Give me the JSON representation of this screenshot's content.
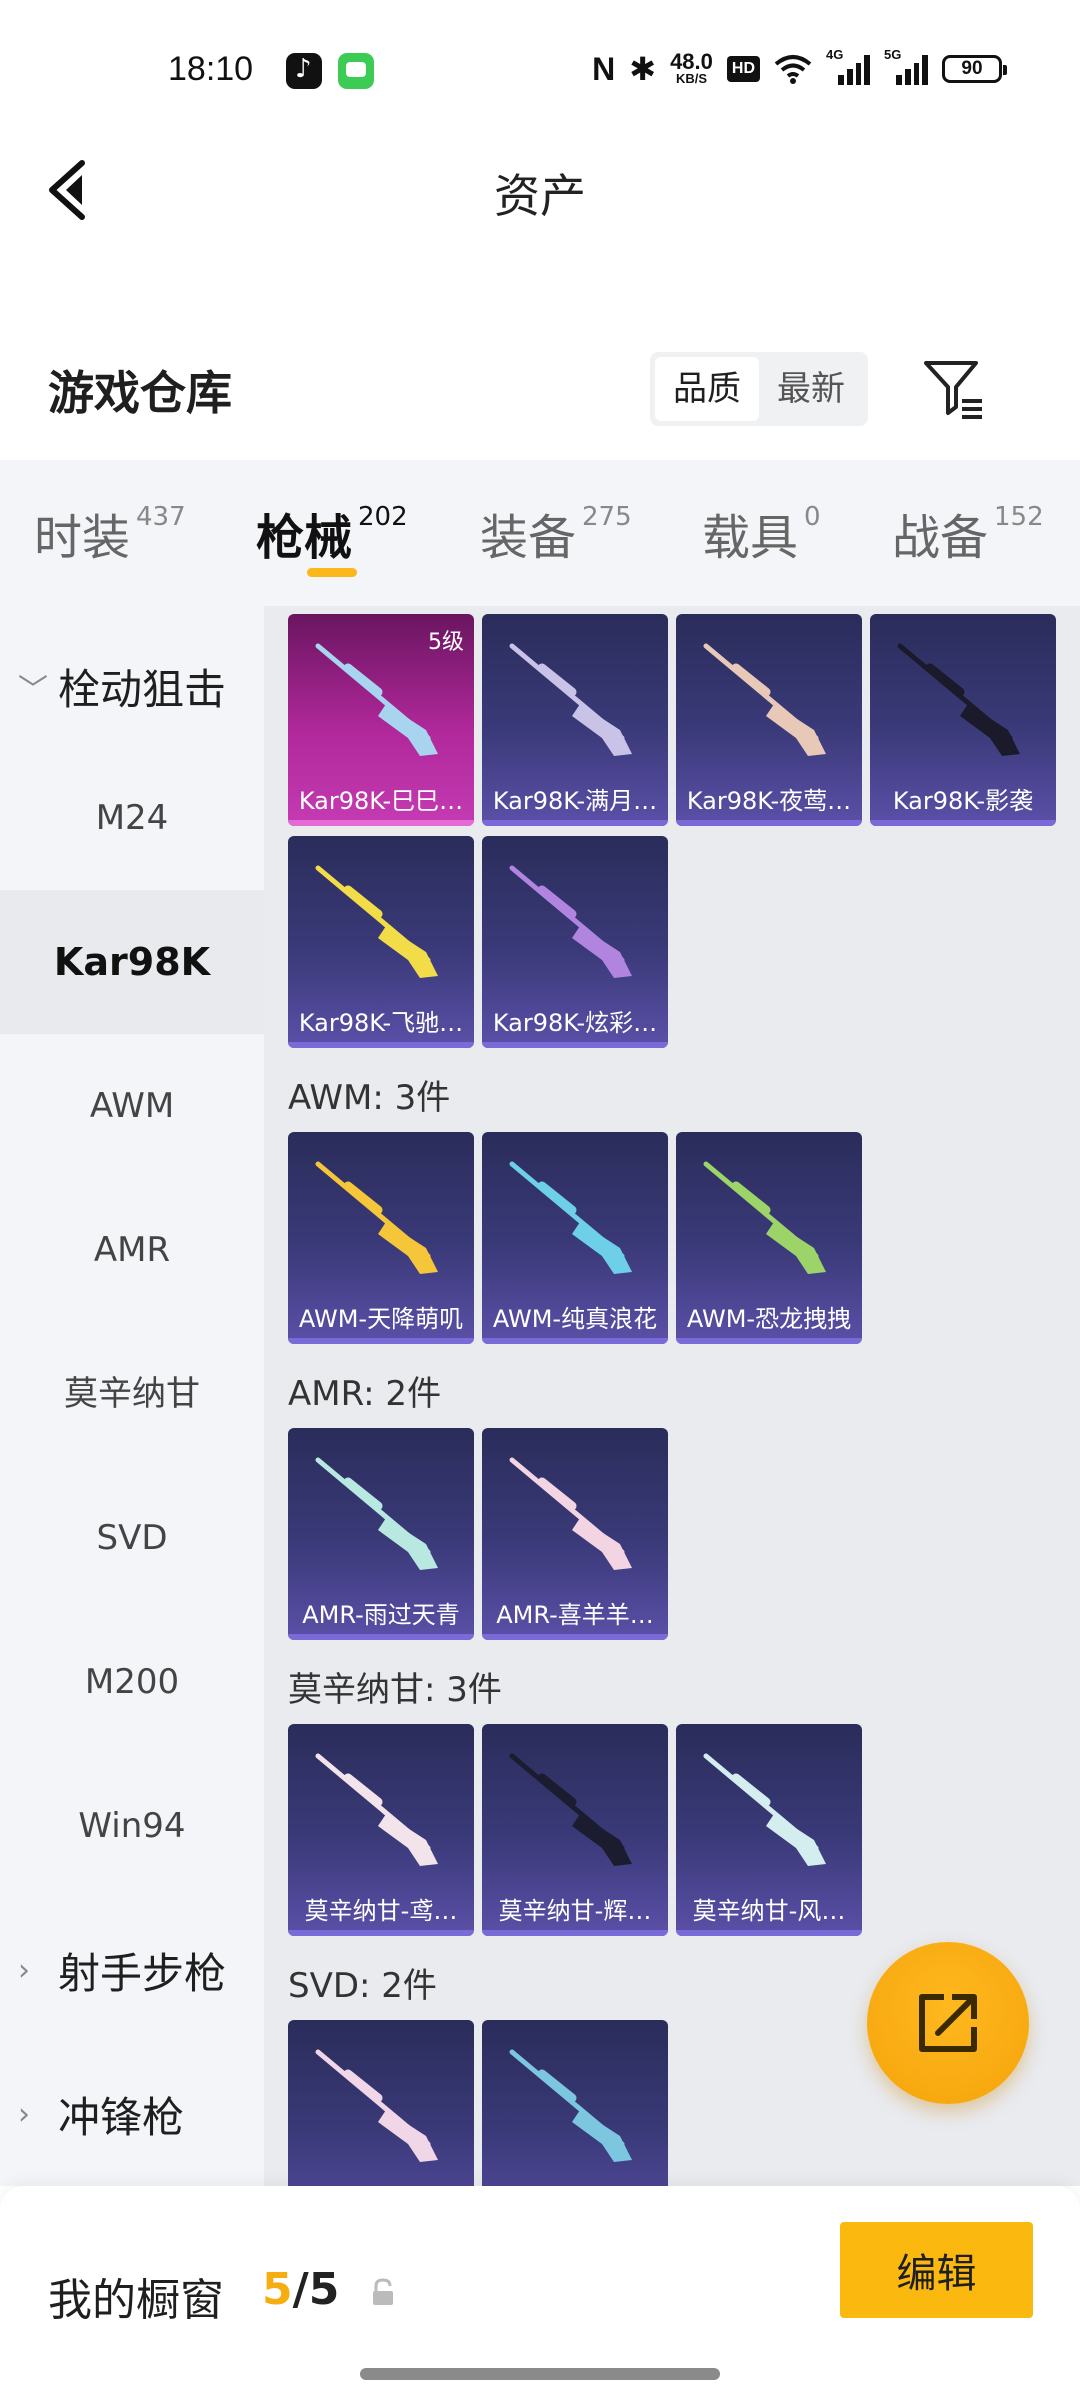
{
  "status_bar": {
    "time": "18:10",
    "net_speed_value": "48.0",
    "net_speed_unit": "KB/S",
    "hd_badge": "HD",
    "sig1_label": "4G",
    "sig2_label": "5G",
    "battery": "90"
  },
  "header": {
    "title": "资产"
  },
  "warehouse": {
    "title": "游戏仓库",
    "sort_options": [
      "品质",
      "最新"
    ],
    "active_sort": "品质"
  },
  "category_tabs": [
    {
      "name": "时装",
      "count": "437"
    },
    {
      "name": "枪械",
      "count": "202",
      "active": true
    },
    {
      "name": "装备",
      "count": "275"
    },
    {
      "name": "载具",
      "count": "0"
    },
    {
      "name": "战备",
      "count": "152"
    }
  ],
  "sidebar": {
    "group_1": "栓动狙击",
    "items": [
      "M24",
      "Kar98K",
      "AWM",
      "AMR",
      "莫辛纳甘",
      "SVD",
      "M200",
      "Win94"
    ],
    "active_item": "Kar98K",
    "group_2": "射手步枪",
    "group_3": "冲锋枪"
  },
  "kar98k_cards": [
    {
      "label": "Kar98K-巳巳…",
      "level": "5级",
      "quality": "legend",
      "color": "#a9d4f0"
    },
    {
      "label": "Kar98K-满月…",
      "quality": "epic",
      "color": "#c9c3e8"
    },
    {
      "label": "Kar98K-夜莺…",
      "quality": "epic",
      "color": "#e8c9b8"
    },
    {
      "label": "Kar98K-影袭",
      "quality": "epic",
      "color": "#1a1a2a"
    },
    {
      "label": "Kar98K-飞驰…",
      "quality": "epic",
      "color": "#f2dd48"
    },
    {
      "label": "Kar98K-炫彩…",
      "quality": "epic",
      "color": "#b184e0"
    }
  ],
  "groups": [
    {
      "title": "AWM: 3件",
      "cards": [
        {
          "label": "AWM-天降萌叽",
          "color": "#f5c53a"
        },
        {
          "label": "AWM-纯真浪花",
          "color": "#6ed0e8"
        },
        {
          "label": "AWM-恐龙拽拽",
          "color": "#9cd46a"
        }
      ]
    },
    {
      "title": "AMR: 2件",
      "cards": [
        {
          "label": "AMR-雨过天青",
          "color": "#b8e8e0"
        },
        {
          "label": "AMR-喜羊羊…",
          "color": "#f2d4e2"
        }
      ]
    },
    {
      "title": "莫辛纳甘: 3件",
      "cards": [
        {
          "label": "莫辛纳甘-鸢…",
          "color": "#f2e4ea"
        },
        {
          "label": "莫辛纳甘-辉…",
          "color": "#1c1c30"
        },
        {
          "label": "莫辛纳甘-风…",
          "color": "#d4eef0"
        }
      ]
    },
    {
      "title": "SVD: 2件",
      "cards": [
        {
          "label": "",
          "color": "#f0d6e6"
        },
        {
          "label": "",
          "color": "#7cc6e0"
        }
      ]
    }
  ],
  "bottom_bar": {
    "showcase_label": "我的橱窗",
    "showcase_current": "5",
    "showcase_sep": "/",
    "showcase_total": "5",
    "edit_label": "编辑"
  }
}
